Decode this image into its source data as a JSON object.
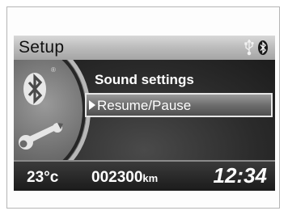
{
  "header": {
    "title": "Setup",
    "icons": [
      "usb-icon",
      "bluetooth-icon"
    ]
  },
  "sidebar": {
    "icons": [
      "bluetooth-icon",
      "wrench-icon"
    ],
    "registered_mark": "®"
  },
  "menu": {
    "current_item": "Sound settings",
    "selected_item": "Resume/Pause"
  },
  "status": {
    "temperature": "23°c",
    "odometer": "002300",
    "odometer_unit": "km",
    "clock": "12:34"
  },
  "colors": {
    "screen_bg": "#2c2c2c",
    "header_bg": "#b9b9b9",
    "text": "#ffffff",
    "highlight_border": "#e6e6e6"
  }
}
